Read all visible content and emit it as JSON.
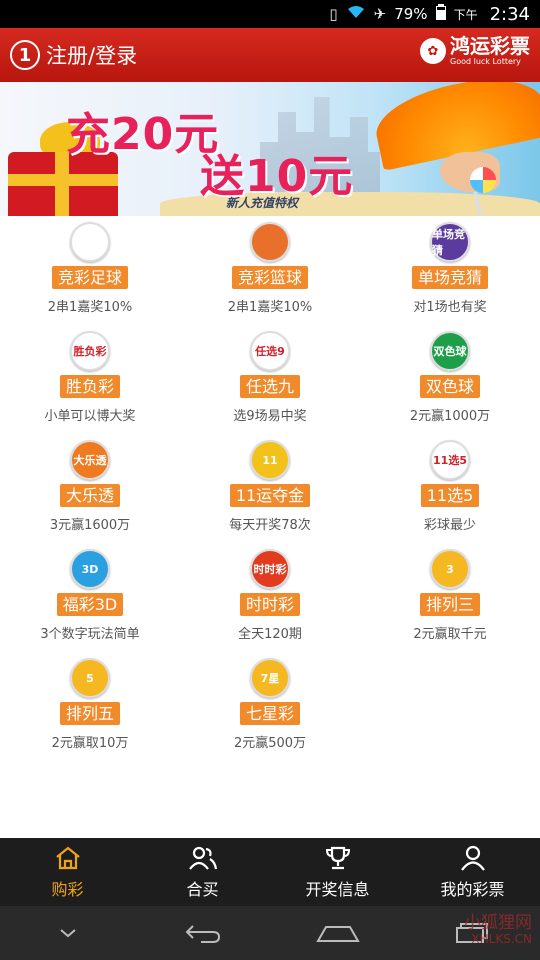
{
  "status_bar": {
    "battery": "79%",
    "ampm": "下午",
    "time": "2:34"
  },
  "header": {
    "login_icon_text": "1",
    "login_label": "注册/登录",
    "brand_cn": "鸿运彩票",
    "brand_en": "Good luck Lottery"
  },
  "banner": {
    "line1": "充20元",
    "line2": "送10元",
    "line3": "新人充值特权"
  },
  "games": [
    {
      "name": "竞彩足球",
      "desc": "2串1嘉奖10%",
      "icon": "soccer-ball-icon",
      "icon_text": "",
      "color": "#ffffff"
    },
    {
      "name": "竞彩篮球",
      "desc": "2串1嘉奖10%",
      "icon": "basketball-icon",
      "icon_text": "",
      "color": "#e8702a"
    },
    {
      "name": "单场竞猜",
      "desc": "对1场也有奖",
      "icon": "single-match-icon",
      "icon_text": "单场竞猜",
      "color": "#5b3b9e"
    },
    {
      "name": "胜负彩",
      "desc": "小单可以博大奖",
      "icon": "win-lose-icon",
      "icon_text": "胜负彩",
      "color": "#ffffff"
    },
    {
      "name": "任选九",
      "desc": "选9场易中奖",
      "icon": "pick-nine-icon",
      "icon_text": "任选9",
      "color": "#ffffff"
    },
    {
      "name": "双色球",
      "desc": "2元赢1000万",
      "icon": "union-lotto-icon",
      "icon_text": "双色球",
      "color": "#1f9e4a"
    },
    {
      "name": "大乐透",
      "desc": "3元赢1600万",
      "icon": "super-lotto-icon",
      "icon_text": "大乐透",
      "color": "#f07a20"
    },
    {
      "name": "11运夺金",
      "desc": "每天开奖78次",
      "icon": "eleven-gold-icon",
      "icon_text": "11",
      "color": "#f2c21b"
    },
    {
      "name": "11选5",
      "desc": "彩球最少",
      "icon": "eleven-five-icon",
      "icon_text": "11选5",
      "color": "#ffffff"
    },
    {
      "name": "福彩3D",
      "desc": "3个数字玩法简单",
      "icon": "welfare-3d-icon",
      "icon_text": "3D",
      "color": "#2aa0e0"
    },
    {
      "name": "时时彩",
      "desc": "全天120期",
      "icon": "timely-lottery-icon",
      "icon_text": "时时彩",
      "color": "#e23b1f"
    },
    {
      "name": "排列三",
      "desc": "2元赢取千元",
      "icon": "arrange-three-icon",
      "icon_text": "3",
      "color": "#f5b820"
    },
    {
      "name": "排列五",
      "desc": "2元赢取10万",
      "icon": "arrange-five-icon",
      "icon_text": "5",
      "color": "#f5b820"
    },
    {
      "name": "七星彩",
      "desc": "2元赢500万",
      "icon": "seven-star-icon",
      "icon_text": "7星",
      "color": "#f5b820"
    }
  ],
  "tabs": [
    {
      "label": "购彩",
      "icon": "home-icon",
      "active": true
    },
    {
      "label": "合买",
      "icon": "group-buy-icon",
      "active": false
    },
    {
      "label": "开奖信息",
      "icon": "trophy-icon",
      "active": false
    },
    {
      "label": "我的彩票",
      "icon": "user-icon",
      "active": false
    }
  ],
  "watermark": {
    "line1": "小狐狸网",
    "line2": "XHLKS.CN"
  }
}
